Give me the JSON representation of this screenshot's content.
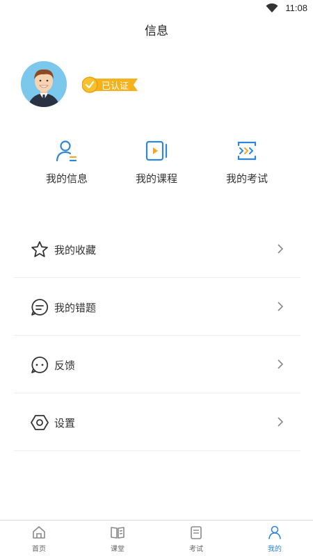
{
  "status_bar": {
    "time": "11:08",
    "wifi_icon": "wifi-icon"
  },
  "header": {
    "title": "信息"
  },
  "profile": {
    "avatar_icon": "avatar-icon",
    "badge_label": "已认证",
    "badge_color": "#f5b21c"
  },
  "quick_links": [
    {
      "label": "我的信息",
      "icon": "user-info-icon"
    },
    {
      "label": "我的课程",
      "icon": "course-video-icon"
    },
    {
      "label": "我的考试",
      "icon": "exam-icon"
    }
  ],
  "menu": [
    {
      "label": "我的收藏",
      "icon": "star-icon"
    },
    {
      "label": "我的错题",
      "icon": "chat-bubble-icon"
    },
    {
      "label": "反馈",
      "icon": "feedback-icon"
    },
    {
      "label": "设置",
      "icon": "hexagon-settings-icon"
    }
  ],
  "tabbar": {
    "accent": "#2f86d8",
    "items": [
      {
        "label": "首页",
        "icon": "home-icon"
      },
      {
        "label": "课堂",
        "icon": "book-icon"
      },
      {
        "label": "考试",
        "icon": "exam-tab-icon"
      },
      {
        "label": "我的",
        "icon": "profile-tab-icon",
        "active": true
      }
    ]
  }
}
